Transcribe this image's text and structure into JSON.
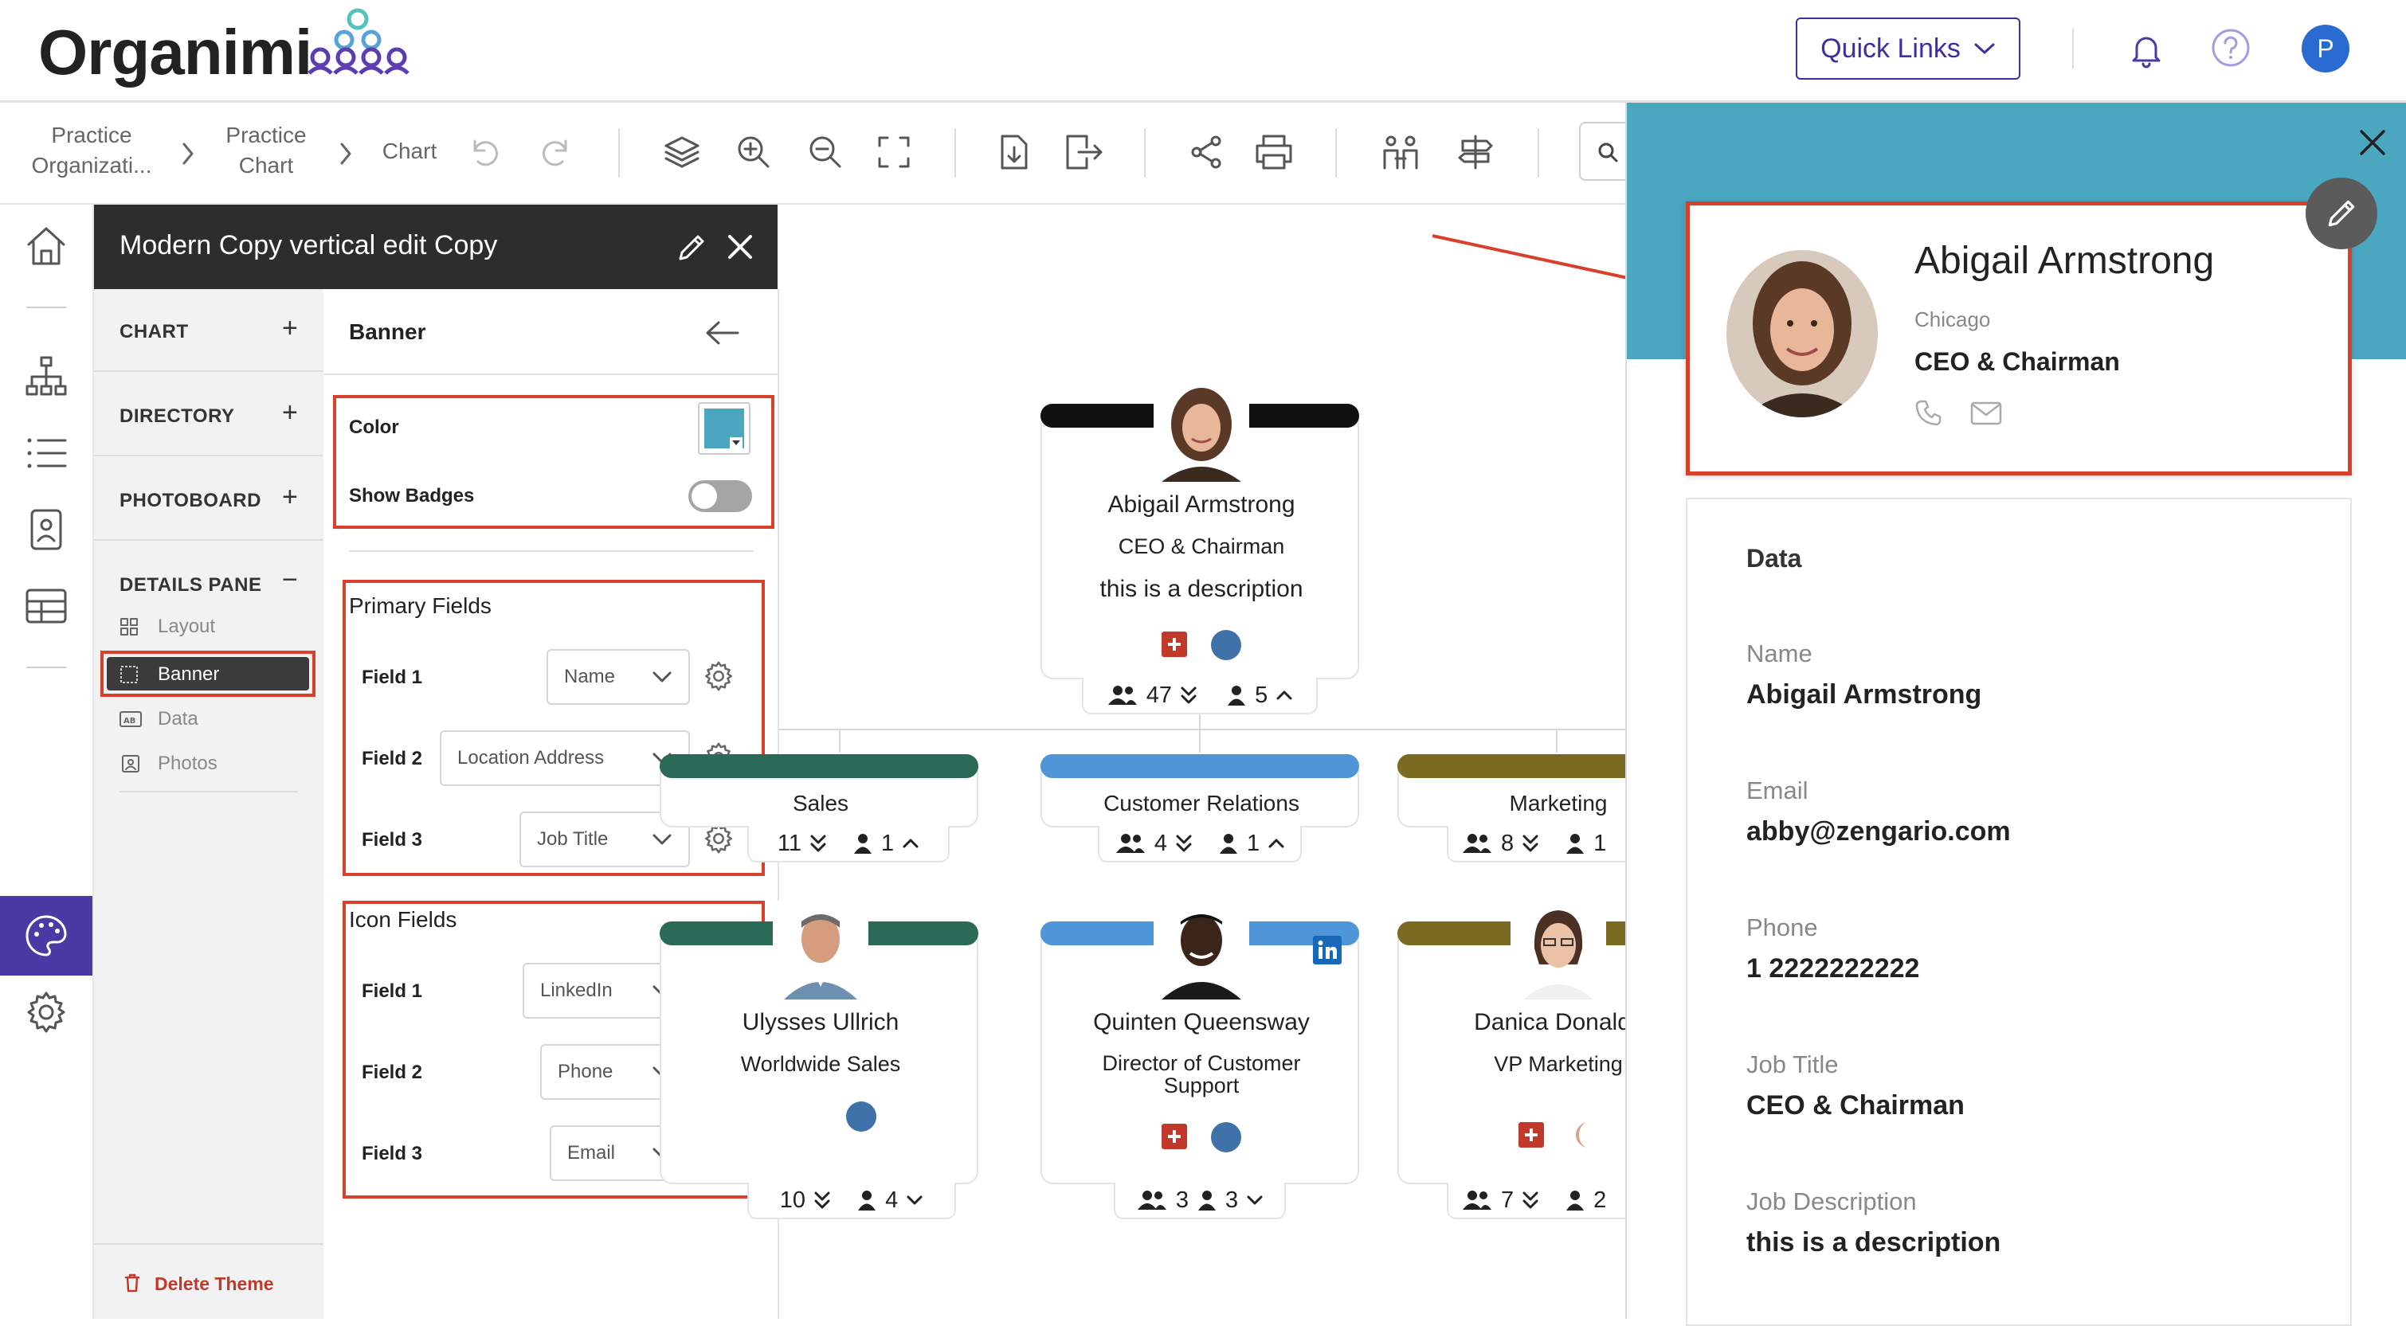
{
  "app": {
    "logo_text": "Organimi"
  },
  "header": {
    "quick_links_label": "Quick Links",
    "avatar_initial": "P"
  },
  "breadcrumb": [
    {
      "line1": "Practice",
      "line2": "Organizati..."
    },
    {
      "line1": "Practice",
      "line2": "Chart"
    },
    {
      "line1": "Chart",
      "line2": ""
    }
  ],
  "search": {
    "placeholder": ""
  },
  "theme_panel": {
    "title": "Modern Copy vertical edit Copy",
    "sections": [
      {
        "label": "CHART",
        "toggle": "+"
      },
      {
        "label": "DIRECTORY",
        "toggle": "+"
      },
      {
        "label": "PHOTOBOARD",
        "toggle": "+"
      },
      {
        "label": "DETAILS PANE",
        "toggle": "−"
      }
    ],
    "details_items": [
      "Layout",
      "Banner",
      "Data",
      "Photos"
    ],
    "selected_item": "Banner",
    "delete_label": "Delete Theme"
  },
  "banner_settings": {
    "heading": "Banner",
    "color_label": "Color",
    "color_value": "#4ba6c0",
    "show_badges_label": "Show Badges",
    "show_badges_on": false,
    "primary_title": "Primary Fields",
    "primary_fields": [
      {
        "label": "Field 1",
        "value": "Name"
      },
      {
        "label": "Field 2",
        "value": "Location Address"
      },
      {
        "label": "Field 3",
        "value": "Job Title"
      }
    ],
    "icon_title": "Icon Fields",
    "icon_fields": [
      {
        "label": "Field 1",
        "value": "LinkedIn"
      },
      {
        "label": "Field 2",
        "value": "Phone"
      },
      {
        "label": "Field 3",
        "value": "Email"
      }
    ]
  },
  "chart": {
    "root": {
      "name": "Abigail Armstrong",
      "title": "CEO & Chairman",
      "description": "this is a description",
      "total": "47",
      "direct": "5",
      "bar_color": "#111111"
    },
    "departments": [
      {
        "name": "Sales",
        "bar_color": "#2b6a57",
        "total": "11",
        "direct": "1"
      },
      {
        "name": "Customer Relations",
        "bar_color": "#4f96d8",
        "total": "4",
        "direct": "1"
      },
      {
        "name": "Marketing",
        "bar_color": "#7a6a22",
        "total": "8",
        "direct": "1"
      }
    ],
    "people": [
      {
        "name": "Ulysses Ullrich",
        "title": "Worldwide Sales",
        "total": "10",
        "direct": "4"
      },
      {
        "name": "Quinten Queensway",
        "title": "Director of Customer Support",
        "total": "3",
        "direct": "3"
      },
      {
        "name": "Danica Donalds",
        "title": "VP Marketing",
        "total": "7",
        "direct": "2"
      }
    ]
  },
  "details_pane": {
    "banner_color": "#4ba6c0",
    "name": "Abigail Armstrong",
    "location": "Chicago",
    "job_title": "CEO & Chairman",
    "data_heading": "Data",
    "fields": [
      {
        "label": "Name",
        "value": "Abigail Armstrong"
      },
      {
        "label": "Email",
        "value": "abby@zengario.com"
      },
      {
        "label": "Phone",
        "value": "1 2222222222"
      },
      {
        "label": "Job Title",
        "value": "CEO & Chairman"
      },
      {
        "label": "Job Description",
        "value": "this is a description"
      }
    ]
  }
}
